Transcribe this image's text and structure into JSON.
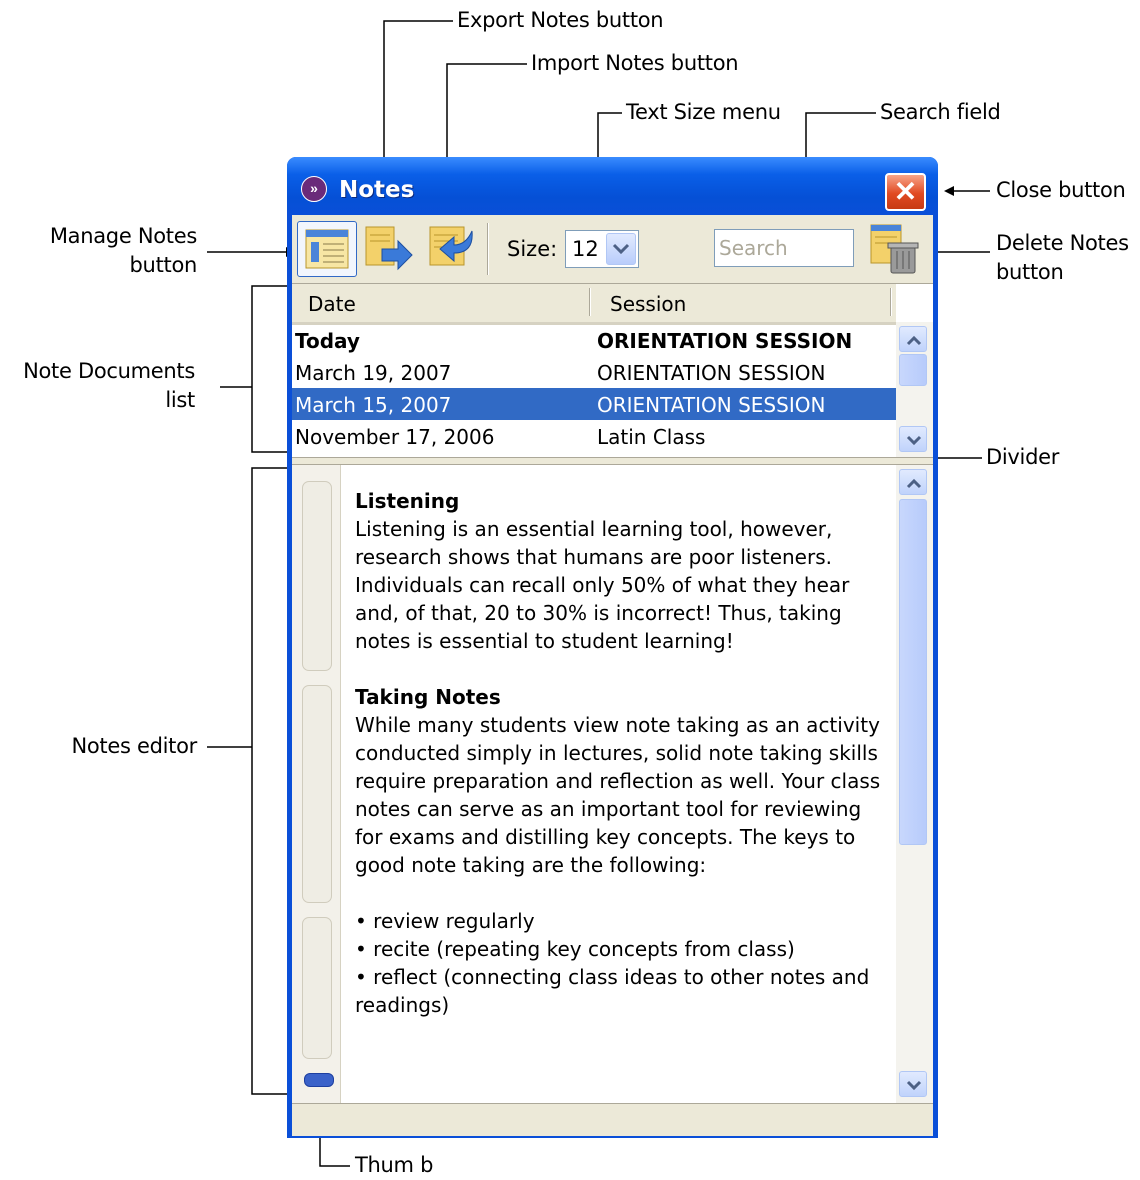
{
  "callouts": {
    "export_notes": "Export Notes button",
    "import_notes": "Import Notes button",
    "text_size": "Text Size menu",
    "search_field": "Search field",
    "close_button": "Close button",
    "manage_notes_1": "Manage Notes",
    "manage_notes_2": "button",
    "delete_notes_1": "Delete Notes",
    "delete_notes_2": "button",
    "note_docs_1": "Note Documents",
    "note_docs_2": "list",
    "divider": "Divider",
    "notes_editor": "Notes editor",
    "thumb": "Thum b"
  },
  "window": {
    "title": "Notes",
    "close_glyph": "✕",
    "app_icon_glyph": "»"
  },
  "toolbar": {
    "size_label": "Size:",
    "size_value": "12",
    "search_placeholder": "Search",
    "icons": [
      "manage-notes-icon",
      "export-notes-icon",
      "import-notes-icon",
      "delete-notes-icon"
    ]
  },
  "list": {
    "columns": [
      "Date",
      "Session"
    ],
    "rows": [
      {
        "date": "Today",
        "session": "ORIENTATION SESSION"
      },
      {
        "date": "March 19, 2007",
        "session": "ORIENTATION SESSION"
      },
      {
        "date": "March 15, 2007",
        "session": "ORIENTATION SESSION"
      },
      {
        "date": "November 17, 2006",
        "session": "Latin Class"
      }
    ]
  },
  "editor": {
    "section1_heading": "Listening",
    "section1_body": "Listening is an essential learning tool, however, research shows that humans are poor listeners. Individuals can recall only 50% of what they hear and, of that, 20 to 30% is incorrect! Thus, taking notes  is essential to student learning!",
    "section2_heading": "Taking Notes",
    "section2_body": "While many students view note taking as an activity conducted simply in lectures, solid note taking skills require preparation and reflection as well. Your class notes can serve as an important tool for reviewing for exams and distilling key concepts. The keys to good note taking are the following:",
    "bullets": [
      "• review regularly",
      "• recite (repeating key concepts from class)",
      "• reflect (connecting class ideas to other notes and readings)"
    ]
  },
  "colors": {
    "title_bar": "#0a4fd8",
    "selection": "#316ac5",
    "close_button": "#e14a22",
    "chrome": "#ece9d8"
  }
}
